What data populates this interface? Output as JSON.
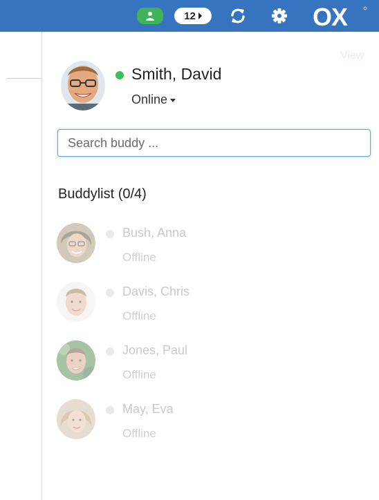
{
  "header": {
    "badge_count": "12",
    "logo_text": "OX",
    "colors": {
      "bar": "#3774c0",
      "presence": "#3fb25a"
    }
  },
  "view_label": "View",
  "current_user": {
    "name": "Smith, David",
    "status": "Online",
    "status_color": "#3cc15a"
  },
  "search": {
    "placeholder": "Search buddy ..."
  },
  "buddylist": {
    "title": "Buddylist (0/4)",
    "buddies": [
      {
        "name": "Bush, Anna",
        "status": "Offline"
      },
      {
        "name": "Davis, Chris",
        "status": "Offline"
      },
      {
        "name": "Jones, Paul",
        "status": "Offline"
      },
      {
        "name": "May, Eva",
        "status": "Offline"
      }
    ]
  }
}
